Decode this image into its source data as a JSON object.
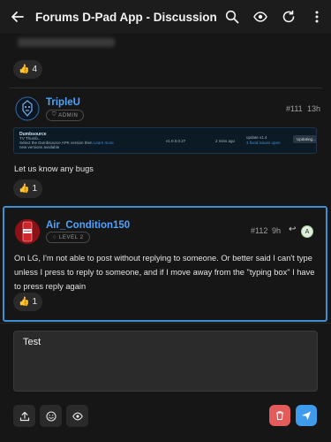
{
  "appbar": {
    "title": "Forums D-Pad App - Discussion",
    "icons": [
      "back-arrow-icon",
      "search-icon",
      "eye-icon",
      "refresh-icon",
      "more-vertical-icon"
    ]
  },
  "previous_post": {
    "reaction_count": "4"
  },
  "post_111": {
    "username": "TripleU",
    "badge": "ADMIN",
    "post_number": "#111",
    "time": "13h",
    "banner": {
      "brand": "Dumbsource",
      "line2": "TV Thumb...",
      "line3_text": "Select the Dumbsource APK version then ",
      "line3_link": "Learn more",
      "line4": "new versions available",
      "version": "v1.0.0.0.27",
      "ago": "2 mins ago",
      "update_title": "update v1.4",
      "update_sub": "3 fixed issues open",
      "button": "Updating..."
    },
    "text": "Let us know any bugs",
    "reaction_count": "1"
  },
  "post_112": {
    "username": "Air_Condition150",
    "badge": "LEVEL 2",
    "post_number": "#112",
    "time": "9h",
    "reply_to_avatar_letter": "A",
    "text": "On LG, I'm not able to post without replying to someone. Or better said I can't type unless I press to reply to someone, and if I move away from the \"typing box\" I have to press reply again",
    "reaction_count": "1"
  },
  "composer": {
    "value": "Test"
  },
  "colors": {
    "accent": "#4da3ff",
    "highlight_border": "#3f8fd4",
    "delete": "#e45b5b",
    "send": "#3f9cec"
  }
}
